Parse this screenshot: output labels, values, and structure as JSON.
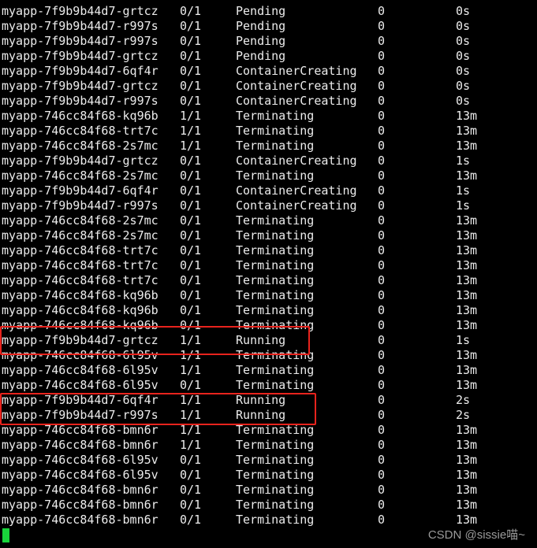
{
  "terminal": {
    "rows": [
      [
        "myapp-7f9b9b44d7-grtcz",
        "0/1",
        "Pending",
        "0",
        "0s"
      ],
      [
        "myapp-7f9b9b44d7-r997s",
        "0/1",
        "Pending",
        "0",
        "0s"
      ],
      [
        "myapp-7f9b9b44d7-r997s",
        "0/1",
        "Pending",
        "0",
        "0s"
      ],
      [
        "myapp-7f9b9b44d7-grtcz",
        "0/1",
        "Pending",
        "0",
        "0s"
      ],
      [
        "myapp-7f9b9b44d7-6qf4r",
        "0/1",
        "ContainerCreating",
        "0",
        "0s"
      ],
      [
        "myapp-7f9b9b44d7-grtcz",
        "0/1",
        "ContainerCreating",
        "0",
        "0s"
      ],
      [
        "myapp-7f9b9b44d7-r997s",
        "0/1",
        "ContainerCreating",
        "0",
        "0s"
      ],
      [
        "myapp-746cc84f68-kq96b",
        "1/1",
        "Terminating",
        "0",
        "13m"
      ],
      [
        "myapp-746cc84f68-trt7c",
        "1/1",
        "Terminating",
        "0",
        "13m"
      ],
      [
        "myapp-746cc84f68-2s7mc",
        "1/1",
        "Terminating",
        "0",
        "13m"
      ],
      [
        "myapp-7f9b9b44d7-grtcz",
        "0/1",
        "ContainerCreating",
        "0",
        "1s"
      ],
      [
        "myapp-746cc84f68-2s7mc",
        "0/1",
        "Terminating",
        "0",
        "13m"
      ],
      [
        "myapp-7f9b9b44d7-6qf4r",
        "0/1",
        "ContainerCreating",
        "0",
        "1s"
      ],
      [
        "myapp-7f9b9b44d7-r997s",
        "0/1",
        "ContainerCreating",
        "0",
        "1s"
      ],
      [
        "myapp-746cc84f68-2s7mc",
        "0/1",
        "Terminating",
        "0",
        "13m"
      ],
      [
        "myapp-746cc84f68-2s7mc",
        "0/1",
        "Terminating",
        "0",
        "13m"
      ],
      [
        "myapp-746cc84f68-trt7c",
        "0/1",
        "Terminating",
        "0",
        "13m"
      ],
      [
        "myapp-746cc84f68-trt7c",
        "0/1",
        "Terminating",
        "0",
        "13m"
      ],
      [
        "myapp-746cc84f68-trt7c",
        "0/1",
        "Terminating",
        "0",
        "13m"
      ],
      [
        "myapp-746cc84f68-kq96b",
        "0/1",
        "Terminating",
        "0",
        "13m"
      ],
      [
        "myapp-746cc84f68-kq96b",
        "0/1",
        "Terminating",
        "0",
        "13m"
      ],
      [
        "myapp-746cc84f68-kq96b",
        "0/1",
        "Terminating",
        "0",
        "13m"
      ],
      [
        "myapp-7f9b9b44d7-grtcz",
        "1/1",
        "Running",
        "0",
        "1s"
      ],
      [
        "myapp-746cc84f68-6l95v",
        "1/1",
        "Terminating",
        "0",
        "13m"
      ],
      [
        "myapp-746cc84f68-6l95v",
        "1/1",
        "Terminating",
        "0",
        "13m"
      ],
      [
        "myapp-746cc84f68-6l95v",
        "0/1",
        "Terminating",
        "0",
        "13m"
      ],
      [
        "myapp-7f9b9b44d7-6qf4r",
        "1/1",
        "Running",
        "0",
        "2s"
      ],
      [
        "myapp-7f9b9b44d7-r997s",
        "1/1",
        "Running",
        "0",
        "2s"
      ],
      [
        "myapp-746cc84f68-bmn6r",
        "1/1",
        "Terminating",
        "0",
        "13m"
      ],
      [
        "myapp-746cc84f68-bmn6r",
        "1/1",
        "Terminating",
        "0",
        "13m"
      ],
      [
        "myapp-746cc84f68-6l95v",
        "0/1",
        "Terminating",
        "0",
        "13m"
      ],
      [
        "myapp-746cc84f68-6l95v",
        "0/1",
        "Terminating",
        "0",
        "13m"
      ],
      [
        "myapp-746cc84f68-bmn6r",
        "0/1",
        "Terminating",
        "0",
        "13m"
      ],
      [
        "myapp-746cc84f68-bmn6r",
        "0/1",
        "Terminating",
        "0",
        "13m"
      ],
      [
        "myapp-746cc84f68-bmn6r",
        "0/1",
        "Terminating",
        "0",
        "13m"
      ]
    ]
  },
  "highlight_color": "#e8231d",
  "cursor_color": "#19d43b",
  "watermark": "CSDN @sissie喵~"
}
